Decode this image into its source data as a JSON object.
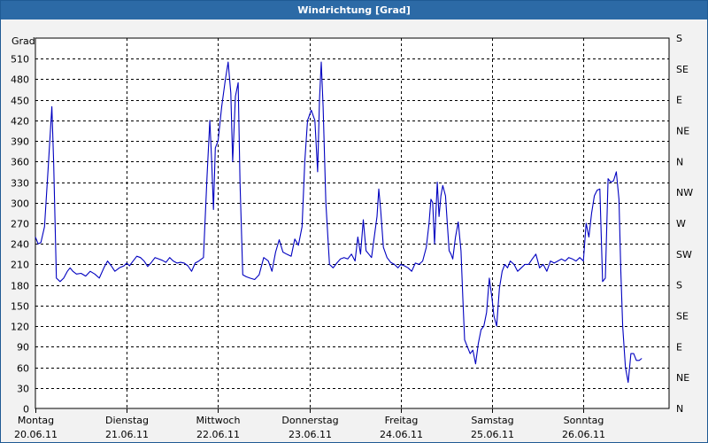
{
  "window": {
    "title": "Windrichtung [Grad]"
  },
  "chart_data": {
    "type": "line",
    "title": "Windrichtung [Grad]",
    "ylabel": "Grad",
    "ylim": [
      0,
      540
    ],
    "grid": true,
    "y_ticks": [
      0,
      30,
      60,
      90,
      120,
      150,
      180,
      210,
      240,
      270,
      300,
      330,
      360,
      390,
      420,
      450,
      480,
      510
    ],
    "right_ticks": [
      "N",
      "NE",
      "E",
      "SE",
      "S",
      "SW",
      "W",
      "NW",
      "N",
      "NE",
      "E",
      "SE",
      "S"
    ],
    "x_ticks": [
      {
        "day": "Montag",
        "date": "20.06.11"
      },
      {
        "day": "Dienstag",
        "date": "21.06.11"
      },
      {
        "day": "Mittwoch",
        "date": "22.06.11"
      },
      {
        "day": "Donnerstag",
        "date": "23.06.11"
      },
      {
        "day": "Freitag",
        "date": "24.06.11"
      },
      {
        "day": "Samstag",
        "date": "25.06.11"
      },
      {
        "day": "Sonntag",
        "date": "26.06.11"
      }
    ],
    "xlim_days": [
      0,
      7
    ],
    "series": [
      {
        "color": "#0000c0",
        "points": [
          [
            0.0,
            250
          ],
          [
            0.03,
            240
          ],
          [
            0.06,
            242
          ],
          [
            0.1,
            265
          ],
          [
            0.14,
            350
          ],
          [
            0.18,
            440
          ],
          [
            0.2,
            360
          ],
          [
            0.23,
            190
          ],
          [
            0.27,
            185
          ],
          [
            0.31,
            190
          ],
          [
            0.35,
            200
          ],
          [
            0.38,
            205
          ],
          [
            0.41,
            200
          ],
          [
            0.45,
            196
          ],
          [
            0.5,
            197
          ],
          [
            0.55,
            193
          ],
          [
            0.6,
            200
          ],
          [
            0.65,
            196
          ],
          [
            0.7,
            190
          ],
          [
            0.75,
            205
          ],
          [
            0.79,
            215
          ],
          [
            0.83,
            208
          ],
          [
            0.87,
            200
          ],
          [
            0.92,
            205
          ],
          [
            0.97,
            208
          ],
          [
            1.0,
            212
          ],
          [
            1.03,
            208
          ],
          [
            1.07,
            215
          ],
          [
            1.11,
            222
          ],
          [
            1.15,
            220
          ],
          [
            1.19,
            215
          ],
          [
            1.23,
            207
          ],
          [
            1.27,
            213
          ],
          [
            1.31,
            220
          ],
          [
            1.35,
            218
          ],
          [
            1.39,
            216
          ],
          [
            1.43,
            213
          ],
          [
            1.47,
            220
          ],
          [
            1.51,
            215
          ],
          [
            1.55,
            212
          ],
          [
            1.59,
            213
          ],
          [
            1.63,
            212
          ],
          [
            1.67,
            208
          ],
          [
            1.71,
            200
          ],
          [
            1.75,
            212
          ],
          [
            1.79,
            215
          ],
          [
            1.84,
            220
          ],
          [
            1.88,
            340
          ],
          [
            1.91,
            420
          ],
          [
            1.93,
            360
          ],
          [
            1.95,
            290
          ],
          [
            1.97,
            380
          ],
          [
            2.0,
            390
          ],
          [
            2.04,
            440
          ],
          [
            2.08,
            480
          ],
          [
            2.11,
            505
          ],
          [
            2.14,
            460
          ],
          [
            2.16,
            360
          ],
          [
            2.19,
            455
          ],
          [
            2.22,
            475
          ],
          [
            2.24,
            330
          ],
          [
            2.27,
            195
          ],
          [
            2.31,
            192
          ],
          [
            2.35,
            190
          ],
          [
            2.4,
            188
          ],
          [
            2.45,
            195
          ],
          [
            2.5,
            220
          ],
          [
            2.55,
            215
          ],
          [
            2.59,
            200
          ],
          [
            2.63,
            228
          ],
          [
            2.67,
            246
          ],
          [
            2.71,
            228
          ],
          [
            2.75,
            225
          ],
          [
            2.8,
            222
          ],
          [
            2.84,
            247
          ],
          [
            2.88,
            238
          ],
          [
            2.92,
            265
          ],
          [
            2.95,
            360
          ],
          [
            2.98,
            420
          ],
          [
            3.02,
            435
          ],
          [
            3.06,
            420
          ],
          [
            3.09,
            345
          ],
          [
            3.11,
            450
          ],
          [
            3.13,
            505
          ],
          [
            3.15,
            440
          ],
          [
            3.18,
            300
          ],
          [
            3.22,
            210
          ],
          [
            3.26,
            205
          ],
          [
            3.3,
            212
          ],
          [
            3.34,
            218
          ],
          [
            3.38,
            220
          ],
          [
            3.42,
            218
          ],
          [
            3.46,
            225
          ],
          [
            3.5,
            215
          ],
          [
            3.53,
            250
          ],
          [
            3.56,
            225
          ],
          [
            3.59,
            275
          ],
          [
            3.62,
            230
          ],
          [
            3.65,
            225
          ],
          [
            3.68,
            220
          ],
          [
            3.71,
            250
          ],
          [
            3.74,
            280
          ],
          [
            3.76,
            320
          ],
          [
            3.78,
            290
          ],
          [
            3.81,
            235
          ],
          [
            3.85,
            220
          ],
          [
            3.89,
            213
          ],
          [
            3.93,
            210
          ],
          [
            3.97,
            205
          ],
          [
            4.0,
            210
          ],
          [
            4.04,
            208
          ],
          [
            4.08,
            205
          ],
          [
            4.12,
            200
          ],
          [
            4.16,
            212
          ],
          [
            4.2,
            210
          ],
          [
            4.24,
            215
          ],
          [
            4.28,
            235
          ],
          [
            4.31,
            270
          ],
          [
            4.33,
            305
          ],
          [
            4.35,
            300
          ],
          [
            4.37,
            240
          ],
          [
            4.4,
            330
          ],
          [
            4.42,
            280
          ],
          [
            4.44,
            310
          ],
          [
            4.46,
            325
          ],
          [
            4.49,
            310
          ],
          [
            4.51,
            270
          ],
          [
            4.53,
            230
          ],
          [
            4.55,
            225
          ],
          [
            4.57,
            218
          ],
          [
            4.6,
            250
          ],
          [
            4.63,
            272
          ],
          [
            4.66,
            230
          ],
          [
            4.68,
            160
          ],
          [
            4.7,
            100
          ],
          [
            4.73,
            90
          ],
          [
            4.76,
            80
          ],
          [
            4.79,
            85
          ],
          [
            4.82,
            65
          ],
          [
            4.85,
            95
          ],
          [
            4.88,
            115
          ],
          [
            4.91,
            120
          ],
          [
            4.94,
            140
          ],
          [
            4.97,
            190
          ],
          [
            5.0,
            160
          ],
          [
            5.02,
            135
          ],
          [
            5.05,
            120
          ],
          [
            5.08,
            175
          ],
          [
            5.11,
            200
          ],
          [
            5.14,
            210
          ],
          [
            5.17,
            205
          ],
          [
            5.2,
            215
          ],
          [
            5.24,
            210
          ],
          [
            5.28,
            200
          ],
          [
            5.32,
            205
          ],
          [
            5.36,
            210
          ],
          [
            5.4,
            210
          ],
          [
            5.44,
            218
          ],
          [
            5.48,
            225
          ],
          [
            5.52,
            205
          ],
          [
            5.56,
            210
          ],
          [
            5.6,
            200
          ],
          [
            5.64,
            215
          ],
          [
            5.68,
            212
          ],
          [
            5.72,
            215
          ],
          [
            5.76,
            218
          ],
          [
            5.8,
            215
          ],
          [
            5.84,
            220
          ],
          [
            5.88,
            218
          ],
          [
            5.92,
            215
          ],
          [
            5.96,
            220
          ],
          [
            6.0,
            215
          ],
          [
            6.03,
            270
          ],
          [
            6.06,
            250
          ],
          [
            6.09,
            285
          ],
          [
            6.12,
            310
          ],
          [
            6.15,
            318
          ],
          [
            6.18,
            320
          ],
          [
            6.21,
            185
          ],
          [
            6.24,
            190
          ],
          [
            6.27,
            335
          ],
          [
            6.3,
            330
          ],
          [
            6.33,
            332
          ],
          [
            6.36,
            345
          ],
          [
            6.39,
            305
          ],
          [
            6.41,
            200
          ],
          [
            6.43,
            120
          ],
          [
            6.46,
            60
          ],
          [
            6.49,
            38
          ],
          [
            6.52,
            80
          ],
          [
            6.55,
            80
          ],
          [
            6.58,
            70
          ],
          [
            6.61,
            70
          ],
          [
            6.64,
            73
          ]
        ]
      }
    ]
  }
}
